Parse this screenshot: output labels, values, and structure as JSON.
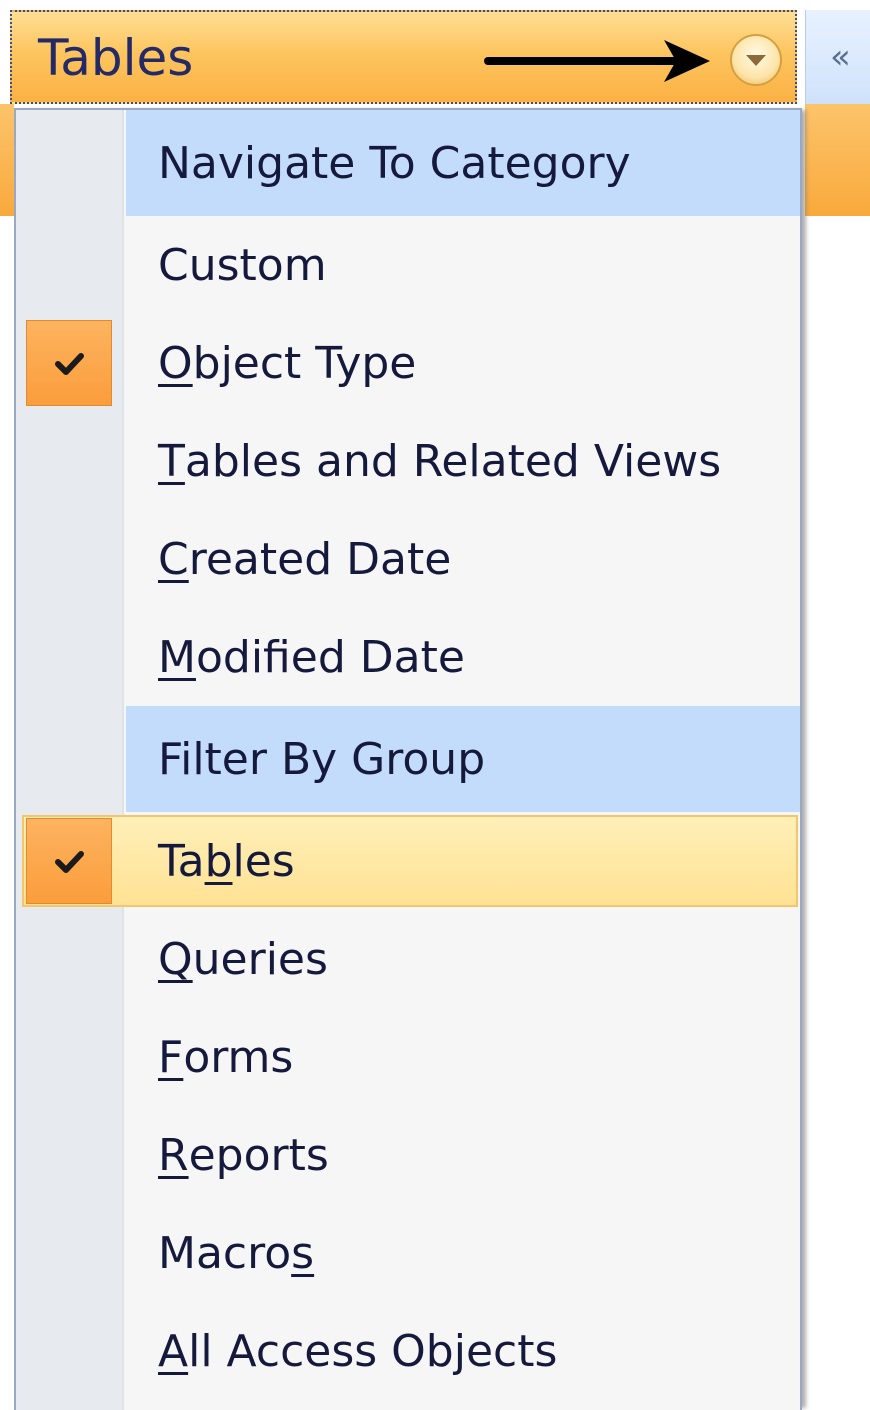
{
  "header": {
    "title": "Tables",
    "dropdown_icon": "chevron-down-circle-icon",
    "shutter_icon": "«"
  },
  "menu": {
    "sections": [
      {
        "heading": "Navigate To Category",
        "items": [
          {
            "pre": "",
            "key": "",
            "post": "Custom",
            "checked": false
          },
          {
            "pre": "",
            "key": "O",
            "post": "bject Type",
            "checked": true
          },
          {
            "pre": "",
            "key": "T",
            "post": "ables and Related Views",
            "checked": false
          },
          {
            "pre": "",
            "key": "C",
            "post": "reated Date",
            "checked": false
          },
          {
            "pre": "",
            "key": "M",
            "post": "odified Date",
            "checked": false
          }
        ]
      },
      {
        "heading": "Filter By Group",
        "items": [
          {
            "pre": "Ta",
            "key": "b",
            "post": "les",
            "checked": true,
            "highlighted": true
          },
          {
            "pre": "",
            "key": "Q",
            "post": "ueries",
            "checked": false
          },
          {
            "pre": "",
            "key": "F",
            "post": "orms",
            "checked": false
          },
          {
            "pre": "",
            "key": "R",
            "post": "eports",
            "checked": false
          },
          {
            "pre": "Macro",
            "key": "s",
            "post": "",
            "checked": false
          },
          {
            "pre": "",
            "key": "A",
            "post": "ll Access Objects",
            "checked": false
          }
        ]
      }
    ]
  },
  "colors": {
    "header_gradient_top": "#fedf95",
    "header_gradient_bottom": "#fbb144",
    "heading_bg": "#c4dcfb",
    "check_bg": "#fb9d3c",
    "highlight_bg": "#ffe294",
    "text": "#15193c"
  }
}
